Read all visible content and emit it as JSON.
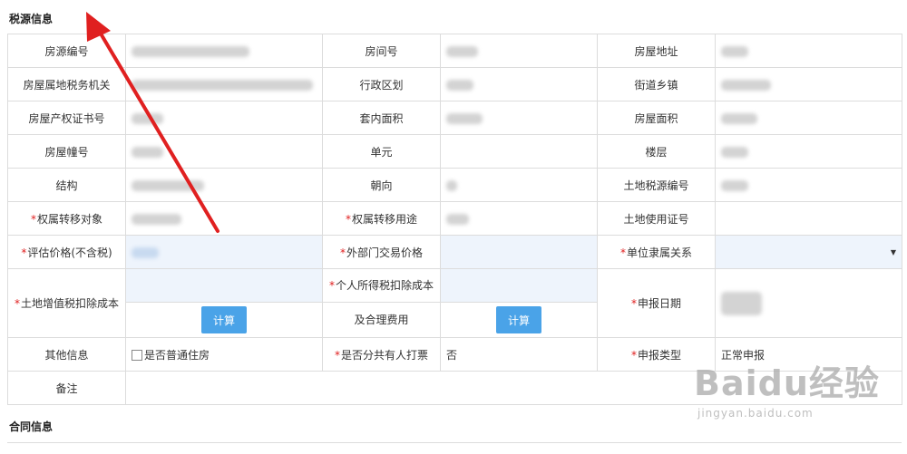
{
  "sections": {
    "tax_source_title": "税源信息",
    "contract_title": "合同信息"
  },
  "labels": {
    "house_source_no": "房源编号",
    "room_no": "房间号",
    "house_address": "房屋地址",
    "tax_authority": "房屋属地税务机关",
    "admin_region": "行政区划",
    "street_town": "街道乡镇",
    "property_cert_no": "房屋产权证书号",
    "inner_area": "套内面积",
    "house_area": "房屋面积",
    "building_no": "房屋幢号",
    "unit": "单元",
    "floor": "楼层",
    "structure": "结构",
    "orientation": "朝向",
    "land_tax_source_no": "土地税源编号",
    "transfer_object": "权属转移对象",
    "transfer_use": "权属转移用途",
    "land_use_cert_no": "土地使用证号",
    "assessed_price": "评估价格(不含税)",
    "external_trade_price": "外部门交易价格",
    "unit_affiliation": "单位隶属关系",
    "land_vat_deduction": "土地增值税扣除成本",
    "pit_deduction_line1": "个人所得税扣除成本",
    "pit_deduction_line2": "及合理费用",
    "declare_date": "申报日期",
    "other_info": "其他信息",
    "ordinary_house": "是否普通住房",
    "co_owner_ticket": "是否分共有人打票",
    "declare_type": "申报类型",
    "remarks": "备注"
  },
  "values": {
    "co_owner_ticket": "否",
    "declare_type": "正常申报"
  },
  "buttons": {
    "calc_1": "计算",
    "calc_2": "计算"
  },
  "required_mark": "*",
  "watermark": {
    "logo": "Baidu经验",
    "url": "jingyan.baidu.com"
  },
  "colors": {
    "required": "#e02020",
    "button": "#4aa3e8",
    "input_bg": "#eef4fc",
    "border": "#dcdcdc",
    "annotation_arrow": "#e02020"
  }
}
